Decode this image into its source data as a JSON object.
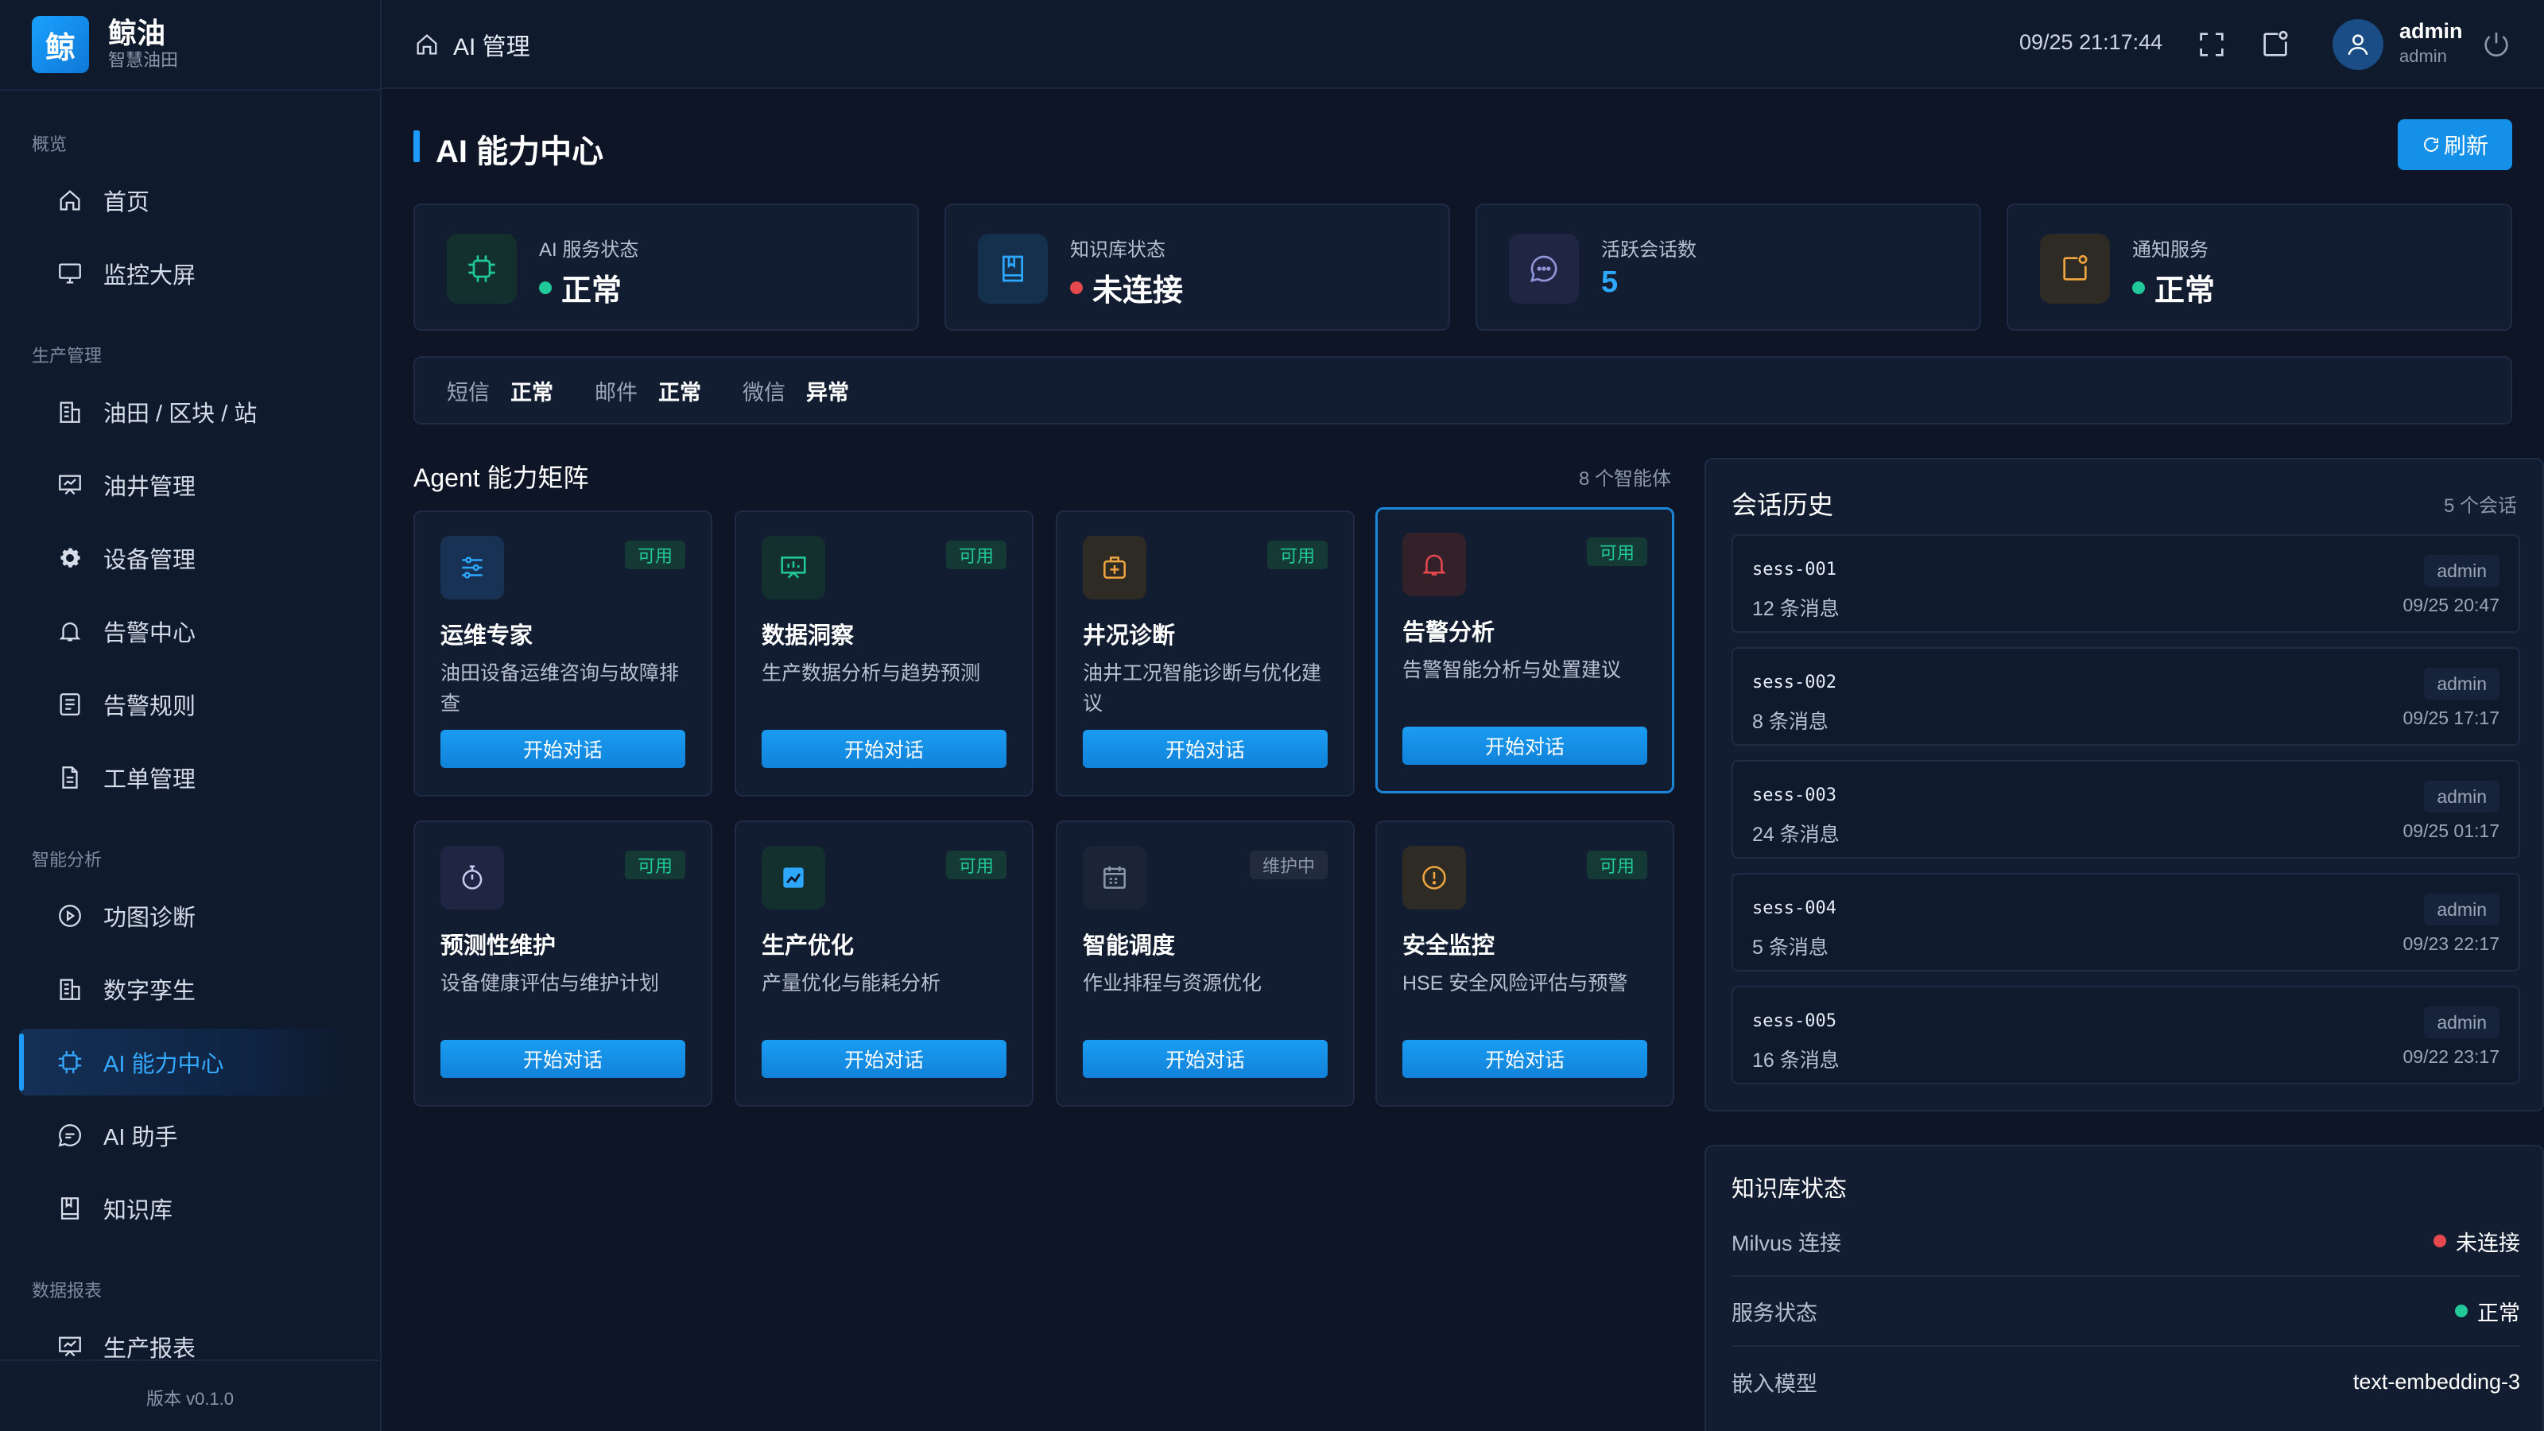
{
  "brand": {
    "logo_char": "鲸",
    "name": "鲸油",
    "sub": "智慧油田"
  },
  "sidebar": {
    "groups": [
      "概览",
      "生产管理",
      "智能分析",
      "数据报表"
    ],
    "items": [
      {
        "label": "首页",
        "icon": "home-icon"
      },
      {
        "label": "监控大屏",
        "icon": "monitor-icon"
      },
      {
        "label": "油田 / 区块 / 站",
        "icon": "building-icon"
      },
      {
        "label": "油井管理",
        "icon": "easel-icon"
      },
      {
        "label": "设备管理",
        "icon": "gear-icon"
      },
      {
        "label": "告警中心",
        "icon": "bell-icon"
      },
      {
        "label": "告警规则",
        "icon": "rules-icon"
      },
      {
        "label": "工单管理",
        "icon": "document-icon"
      },
      {
        "label": "功图诊断",
        "icon": "play-circle-icon"
      },
      {
        "label": "数字孪生",
        "icon": "building-icon"
      },
      {
        "label": "AI 能力中心",
        "icon": "chip-icon"
      },
      {
        "label": "AI 助手",
        "icon": "chat-icon"
      },
      {
        "label": "知识库",
        "icon": "book-icon"
      },
      {
        "label": "生产报表",
        "icon": "easel-icon"
      }
    ],
    "version": "版本 v0.1.0"
  },
  "topbar": {
    "breadcrumb": "AI 管理",
    "datetime": "09/25 21:17:44",
    "user_name": "admin",
    "user_role": "admin"
  },
  "page": {
    "title": "AI 能力中心",
    "refresh_label": "刷新"
  },
  "stats": [
    {
      "label": "AI 服务状态",
      "value": "正常",
      "dot_color": "#20c997",
      "icon": "chip-icon"
    },
    {
      "label": "知识库状态",
      "value": "未连接",
      "dot_color": "#e5484d",
      "icon": "book-icon"
    },
    {
      "label": "活跃会话数",
      "value": "5",
      "icon": "chat-icon"
    },
    {
      "label": "通知服务",
      "value": "正常",
      "dot_color": "#20c997",
      "icon": "notify-icon"
    }
  ],
  "notify": [
    {
      "label": "短信",
      "value": "正常"
    },
    {
      "label": "邮件",
      "value": "正常"
    },
    {
      "label": "微信",
      "value": "异常"
    }
  ],
  "agents": {
    "title": "Agent 能力矩阵",
    "count": "8 个智能体",
    "button_label": "开始对话",
    "items": [
      {
        "name": "运维专家",
        "desc": "油田设备运维咨询与故障排查",
        "badge": "可用",
        "icon": "sliders-icon"
      },
      {
        "name": "数据洞察",
        "desc": "生产数据分析与趋势预测",
        "badge": "可用",
        "icon": "chart-board-icon"
      },
      {
        "name": "井况诊断",
        "desc": "油井工况智能诊断与优化建议",
        "badge": "可用",
        "icon": "medkit-icon"
      },
      {
        "name": "告警分析",
        "desc": "告警智能分析与处置建议",
        "badge": "可用",
        "icon": "bell-icon"
      },
      {
        "name": "预测性维护",
        "desc": "设备健康评估与维护计划",
        "badge": "可用",
        "icon": "stopwatch-icon"
      },
      {
        "name": "生产优化",
        "desc": "产量优化与能耗分析",
        "badge": "可用",
        "icon": "trend-icon"
      },
      {
        "name": "智能调度",
        "desc": "作业排程与资源优化",
        "badge": "维护中",
        "icon": "calendar-icon"
      },
      {
        "name": "安全监控",
        "desc": "HSE 安全风险评估与预警",
        "badge": "可用",
        "icon": "alert-circle-icon"
      }
    ]
  },
  "sessions": {
    "title": "会话历史",
    "count": "5 个会话",
    "items": [
      {
        "id": "sess-001",
        "messages": "12 条消息",
        "user": "admin",
        "time": "09/25 20:47"
      },
      {
        "id": "sess-002",
        "messages": "8 条消息",
        "user": "admin",
        "time": "09/25 17:17"
      },
      {
        "id": "sess-003",
        "messages": "24 条消息",
        "user": "admin",
        "time": "09/25 01:17"
      },
      {
        "id": "sess-004",
        "messages": "5 条消息",
        "user": "admin",
        "time": "09/23 22:17"
      },
      {
        "id": "sess-005",
        "messages": "16 条消息",
        "user": "admin",
        "time": "09/22 23:17"
      }
    ]
  },
  "knowledge": {
    "title": "知识库状态",
    "rows": [
      {
        "label": "Milvus 连接",
        "value": "未连接",
        "dot_color": "#e5484d"
      },
      {
        "label": "服务状态",
        "value": "正常",
        "dot_color": "#20c997"
      },
      {
        "label": "嵌入模型",
        "value": "text-embedding-3"
      }
    ]
  },
  "colors": {
    "accent": "#1e9bff",
    "ok": "#20c997",
    "error": "#e5484d",
    "panel": "#121d31"
  }
}
